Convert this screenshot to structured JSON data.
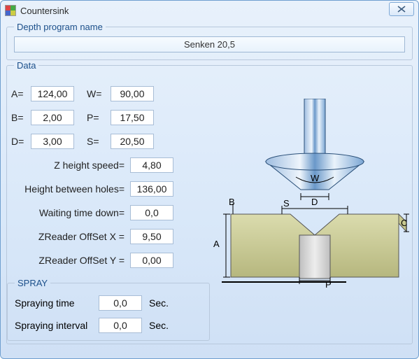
{
  "window": {
    "title": "Countersink"
  },
  "depth_program": {
    "legend": "Depth program name",
    "value": "Senken 20,5"
  },
  "data": {
    "legend": "Data",
    "A_label": "A=",
    "A": "124,00",
    "W_label": "W=",
    "W": "90,00",
    "B_label": "B=",
    "B": "2,00",
    "P_label": "P=",
    "P": "17,50",
    "D_label": "D=",
    "D": "3,00",
    "S_label": "S=",
    "S": "20,50",
    "z_height_speed_label": "Z height speed=",
    "z_height_speed": "4,80",
    "height_between_holes_label": "Height between holes=",
    "height_between_holes": "136,00",
    "waiting_time_down_label": "Waiting time down=",
    "waiting_time_down": "0,0",
    "zreader_offset_x_label": "ZReader OffSet X =",
    "zreader_offset_x": "9,50",
    "zreader_offset_y_label": "ZReader OffSet Y =",
    "zreader_offset_y": "0,00"
  },
  "spray": {
    "legend": "SPRAY",
    "spraying_time_label": "Spraying time",
    "spraying_time": "0,0",
    "spraying_interval_label": "Spraying interval",
    "spraying_interval": "0,0",
    "unit": "Sec."
  },
  "diagram": {
    "labels": {
      "A": "A",
      "B": "B",
      "C": "C",
      "D": "D",
      "P": "P",
      "S": "S",
      "W": "W"
    }
  }
}
